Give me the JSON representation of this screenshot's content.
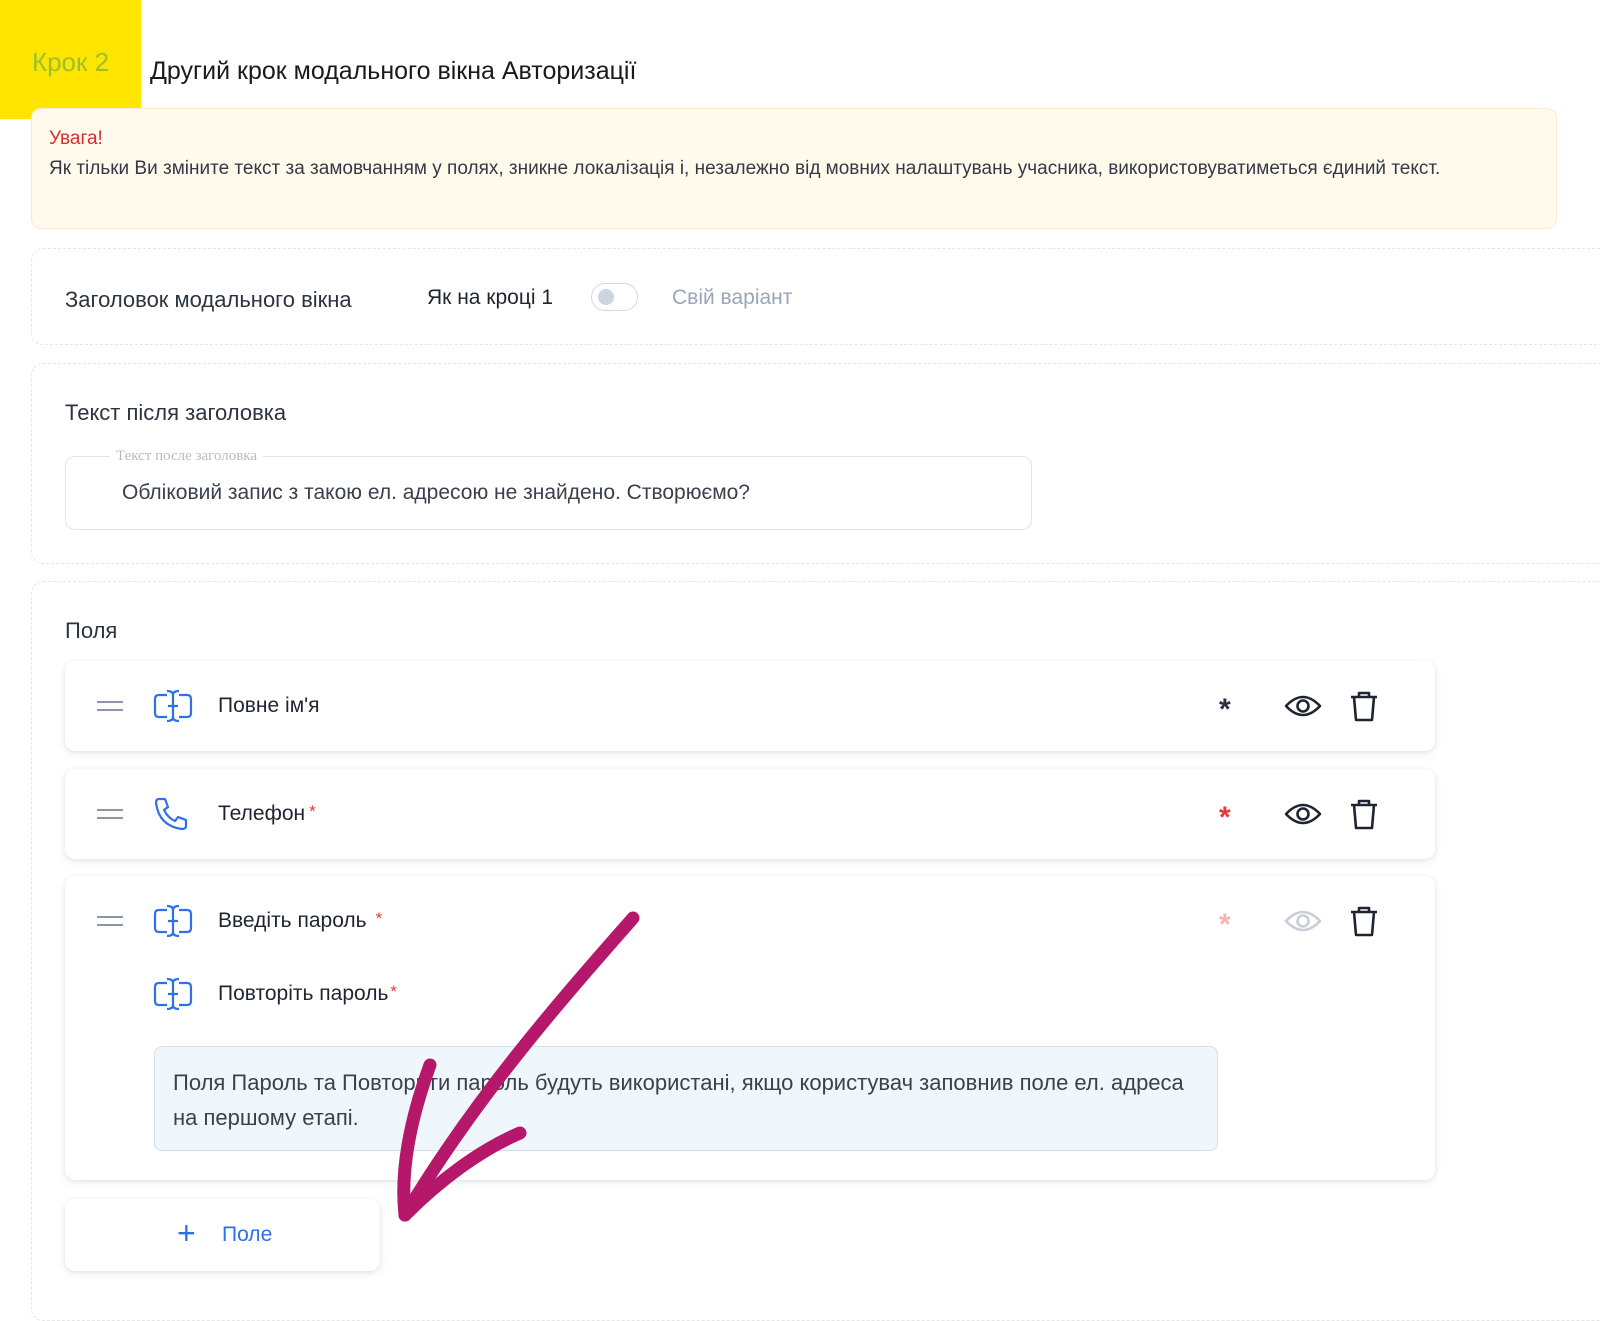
{
  "step": {
    "badge": "Крок 2",
    "title": "Другий крок модального вікна Авторизації"
  },
  "warning": {
    "title": "Увага!",
    "text": "Як тільки Ви зміните текст за замовчанням у полях, зникне локалізація і, незалежно від мовних налаштувань учасника, використовуватиметься єдиний текст."
  },
  "modal_title": {
    "label": "Заголовок модального вікна",
    "option_left": "Як на кроці 1",
    "option_right": "Свій варіант",
    "toggle_on": false
  },
  "text_after": {
    "label": "Текст після заголовка",
    "field_legend": "Текст после заголовка",
    "field_value": "Обліковий запис з такою ел. адресою не знайдено. Створюємо?"
  },
  "fields": {
    "label": "Поля",
    "items": [
      {
        "label": "Повне ім'я",
        "required_mark": "",
        "icon": "text-input-icon",
        "required": false,
        "visible": true
      },
      {
        "label": "Телефон",
        "required_mark": "*",
        "icon": "phone-icon",
        "required": true,
        "visible": true
      },
      {
        "label": "Введіть пароль",
        "required_mark": "*",
        "icon": "text-input-icon",
        "required": true,
        "visible": true,
        "disabled_controls": true
      }
    ],
    "sub_item": {
      "label": "Повторіть пароль",
      "required_mark": "*",
      "icon": "text-input-icon"
    },
    "note": "Поля Пароль та Повторити пароль будуть використані, якщо користувач заповнив поле ел. адреса на першому етапі.",
    "add_button": {
      "plus": "+",
      "label": "Поле"
    }
  },
  "colors": {
    "badge": "#ffe500",
    "badge_text": "#9cc02c",
    "accent": "#2f6fea",
    "required": "#e53935",
    "annotation_arrow": "#b5176a"
  }
}
